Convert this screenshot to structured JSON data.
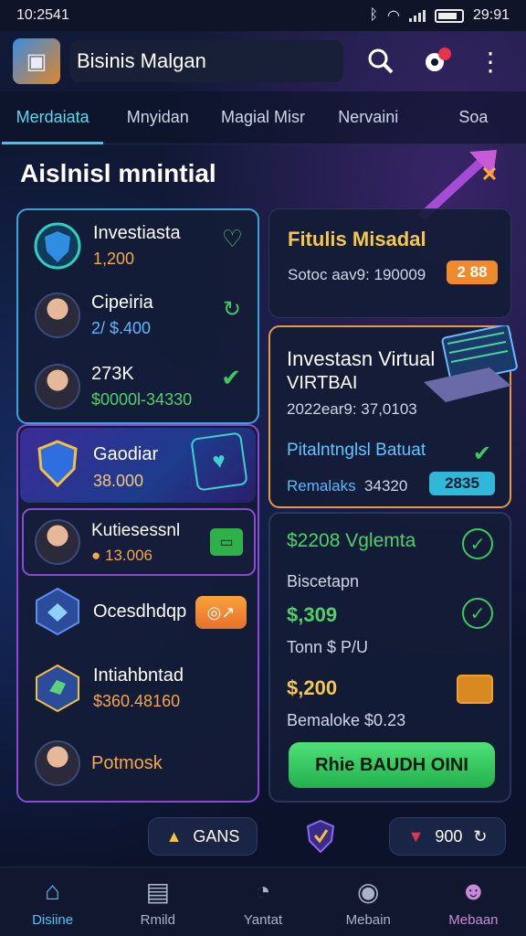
{
  "status_bar": {
    "time": "10:2541",
    "right_text": "29:91",
    "icons": [
      "bluetooth-icon",
      "wifi-icon",
      "signal-icon",
      "battery-icon"
    ]
  },
  "app_bar": {
    "title": "Bisinis Malgan",
    "actions": [
      "search-icon",
      "notification-icon",
      "more-icon"
    ]
  },
  "tabs": [
    {
      "label": "Merdaiata",
      "active": true
    },
    {
      "label": "Mnyidan",
      "active": false
    },
    {
      "label": "Magial Misr",
      "active": false
    },
    {
      "label": "Nervaini",
      "active": false
    },
    {
      "label": "Soa",
      "active": false
    }
  ],
  "section_title": "Aislnisl mnintial",
  "left_top": [
    {
      "name": "Investiasta",
      "value": "1,200",
      "value_color": "orange"
    },
    {
      "name": "Cipeiria",
      "value": "2/ $.400",
      "value_color": "blue"
    },
    {
      "name": "273K",
      "value": "$0000l-34330",
      "value_color": "green"
    }
  ],
  "left_bottom": {
    "banner_title": "Gaodiar",
    "banner_value": "38.000",
    "rows": [
      {
        "name": "Kutiesessnl",
        "value": "13.006"
      },
      {
        "name": "Ocesdhdqp",
        "value": ""
      },
      {
        "name": "Intiahbntad",
        "value": "$360.48160"
      },
      {
        "name": "Potmosk",
        "value": ""
      }
    ]
  },
  "right_top": {
    "title": "Fitulis Misadal",
    "subtitle": "Sotoc aav9: 190009",
    "pill": "2 88"
  },
  "right_mid": {
    "title": "Investasn Virtual",
    "title2": "VIRTBAI",
    "subtitle": "2022ear9: 37,0103",
    "highlight": "Pitalntnglsl Batuat",
    "footer_label": "Remalaks",
    "footer_value": "34320",
    "pill": "2835"
  },
  "right_bottom": {
    "title": "$2208 Vglemta",
    "items": [
      {
        "label": "Biscetapn",
        "value": ""
      },
      {
        "label": "$,309",
        "value": ""
      },
      {
        "label": "Tonn $ P/U",
        "value": ""
      },
      {
        "label": "$,200",
        "value": ""
      },
      {
        "label": "Bemaloke $0.23",
        "value": ""
      }
    ],
    "cta": "Rhie BAUDH OINI"
  },
  "chips": {
    "left": "GANS",
    "right": "900"
  },
  "nav": [
    {
      "label": "Disiine",
      "icon": "home-icon"
    },
    {
      "label": "Rmild",
      "icon": "card-icon"
    },
    {
      "label": "Yantat",
      "icon": "chart-icon"
    },
    {
      "label": "Mebain",
      "icon": "pin-icon"
    },
    {
      "label": "Mebaan",
      "icon": "profile-icon"
    }
  ]
}
